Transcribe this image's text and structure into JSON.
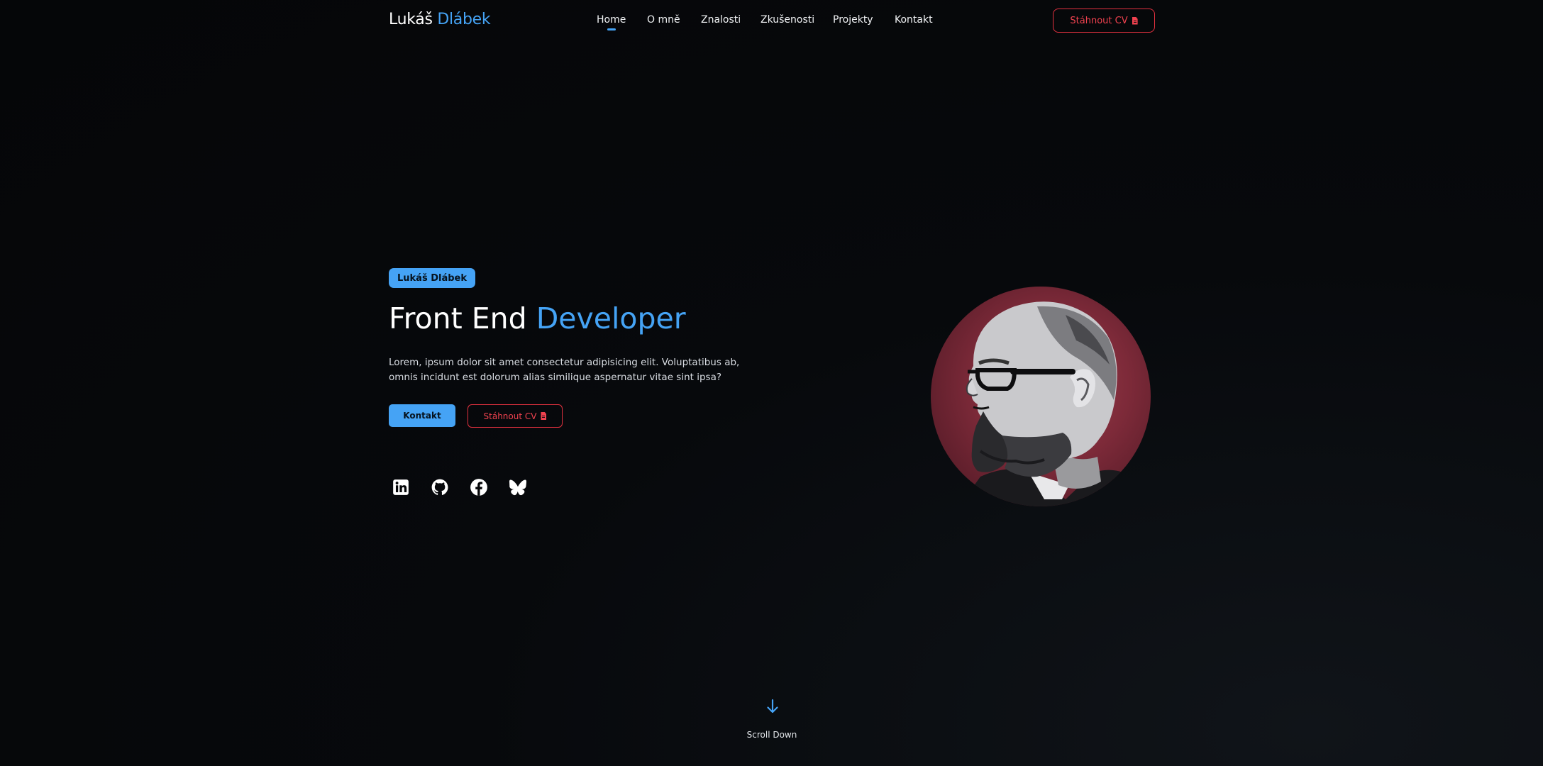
{
  "brand": {
    "first_name": "Lukáš",
    "last_name": "Dlábek",
    "accent_color": "#45a3f5",
    "cv_color": "#e2313f"
  },
  "nav": {
    "items": [
      {
        "label": "Home",
        "active": true
      },
      {
        "label": "O mně",
        "active": false
      },
      {
        "label": "Znalosti",
        "active": false
      },
      {
        "label": "Zkušenosti",
        "active": false
      },
      {
        "label": "Projekty",
        "active": false
      },
      {
        "label": "Kontakt",
        "active": false
      }
    ],
    "cv_button": {
      "label": "Stáhnout CV",
      "icon": "file-icon"
    }
  },
  "hero": {
    "badge": "Lukáš Dlábek",
    "title_part1": "Front End",
    "title_part2": "Developer",
    "description": "Lorem, ipsum dolor sit amet consectetur adipisicing elit. Voluptatibus ab, omnis incidunt est dolorum alias similique aspernatur vitae sint ipsa?",
    "contact_button": "Kontakt",
    "cv_button": "Stáhnout CV",
    "socials": [
      {
        "name": "linkedin",
        "icon": "linkedin-icon"
      },
      {
        "name": "github",
        "icon": "github-icon"
      },
      {
        "name": "facebook",
        "icon": "facebook-icon"
      },
      {
        "name": "bluesky",
        "icon": "bluesky-icon"
      }
    ],
    "portrait": {
      "icon": "profile-photo"
    }
  },
  "scroll": {
    "label": "Scroll Down",
    "icon": "arrow-down-icon"
  }
}
